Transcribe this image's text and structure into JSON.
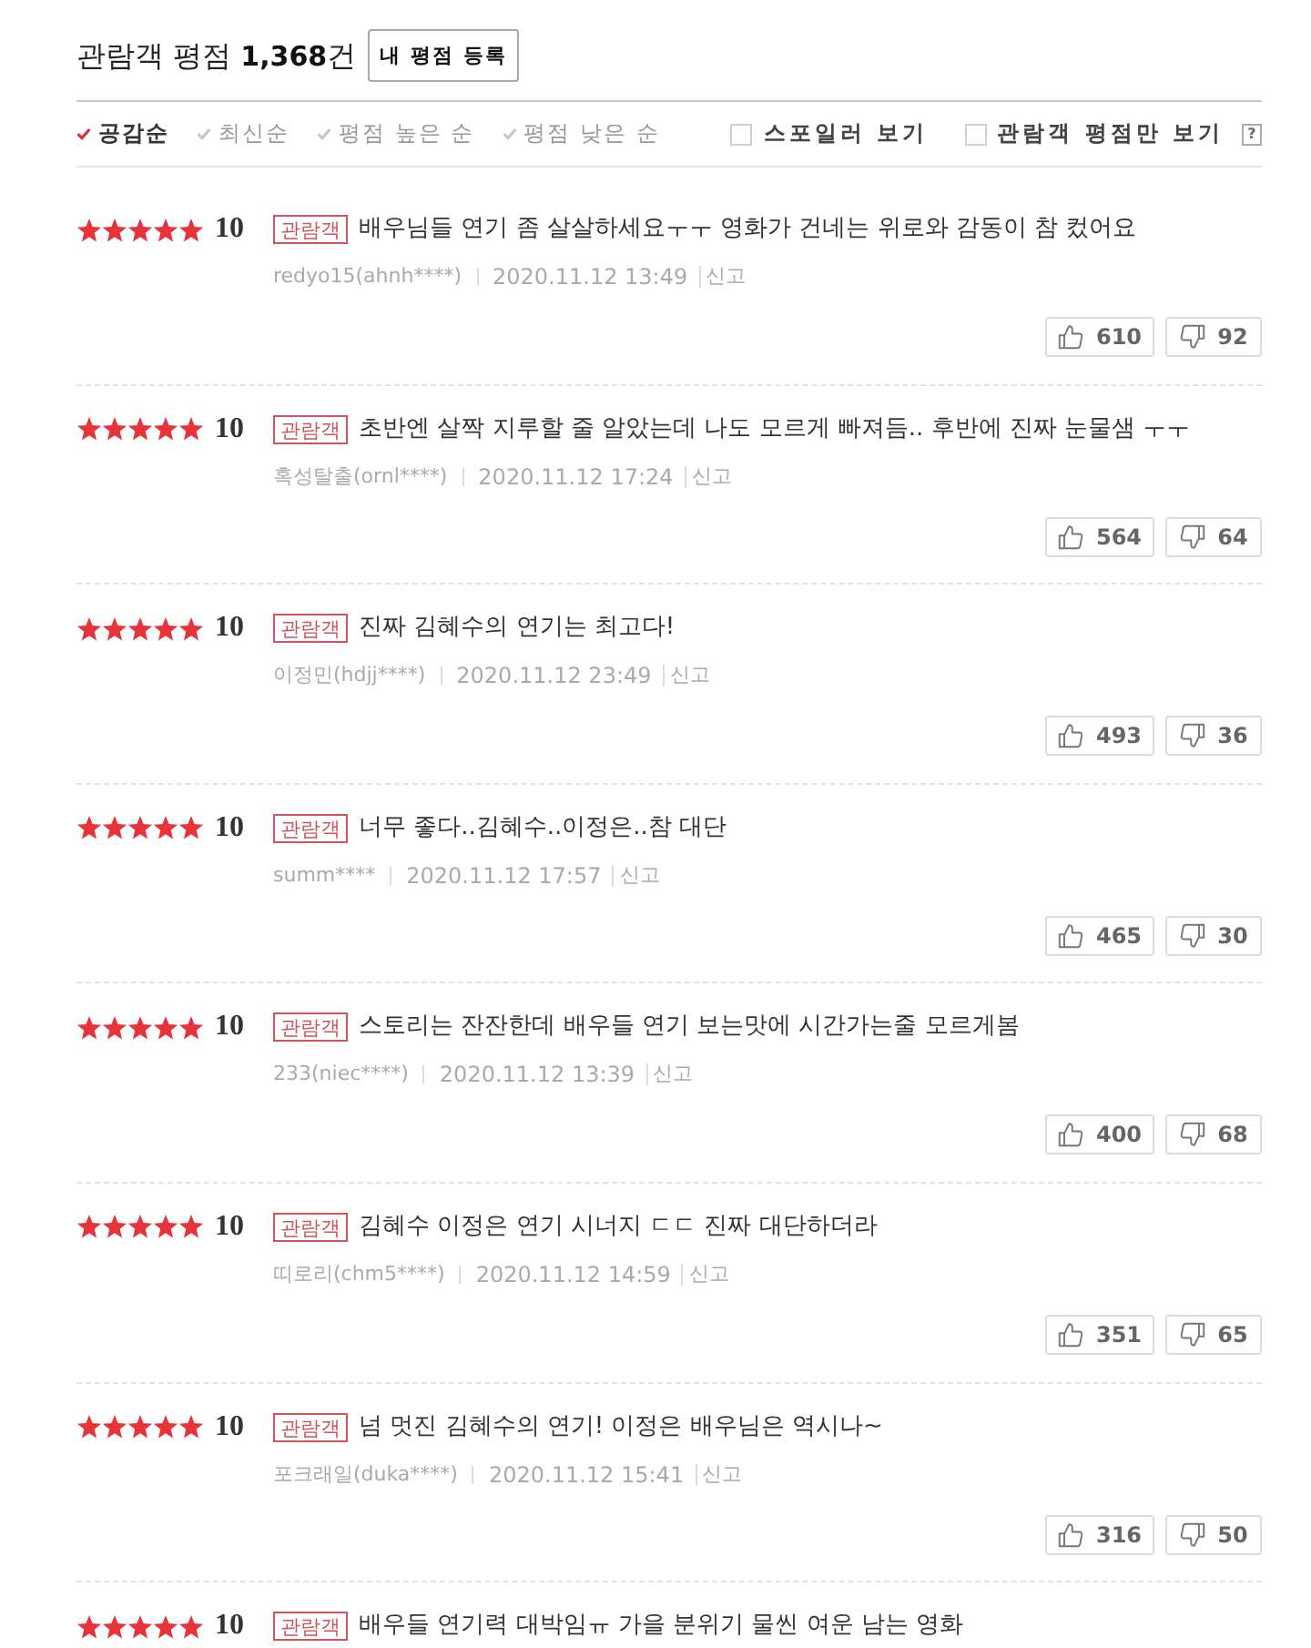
{
  "header": {
    "title": "관람객 평점 **1,368**건",
    "register_button": "내 평점 등록"
  },
  "sort_options": [
    {
      "label": "공감순",
      "selected": true
    },
    {
      "label": "최신순",
      "selected": false
    },
    {
      "label": "평점 높은 순",
      "selected": false
    },
    {
      "label": "평점 낮은 순",
      "selected": false
    }
  ],
  "filters": [
    {
      "label": "스포일러 보기",
      "checked": false
    },
    {
      "label": "관람객 평점만 보기",
      "checked": false
    }
  ],
  "help": "?",
  "reviews": [
    {
      "stars": 5,
      "score": "10",
      "badge": "관람객",
      "text": "배우님들 연기 좀 살살하세요ㅜㅜ 영화가 건네는 위로와 감동이 참 컸어요",
      "author": "redyo15(ahnh****)",
      "date": "2020.11.12 13:49",
      "report": "신고",
      "likes": "610",
      "dislikes": "92"
    },
    {
      "stars": 5,
      "score": "10",
      "badge": "관람객",
      "text": "초반엔 살짝 지루할 줄 알았는데 나도 모르게 빠져듬.. 후반에 진짜 눈물샘 ㅜㅜ",
      "author": "혹성탈출(ornl****)",
      "date": "2020.11.12 17:24",
      "report": "신고",
      "likes": "564",
      "dislikes": "64"
    },
    {
      "stars": 5,
      "score": "10",
      "badge": "관람객",
      "text": "진짜 김혜수의 연기는 최고다!",
      "author": "이정민(hdjj****)",
      "date": "2020.11.12 23:49",
      "report": "신고",
      "likes": "493",
      "dislikes": "36"
    },
    {
      "stars": 5,
      "score": "10",
      "badge": "관람객",
      "text": "너무 좋다..김혜수..이정은..참 대단",
      "author": "summ****",
      "date": "2020.11.12 17:57",
      "report": "신고",
      "likes": "465",
      "dislikes": "30"
    },
    {
      "stars": 5,
      "score": "10",
      "badge": "관람객",
      "text": "스토리는 잔잔한데 배우들 연기 보는맛에 시간가는줄 모르게봄",
      "author": "233(niec****)",
      "date": "2020.11.12 13:39",
      "report": "신고",
      "likes": "400",
      "dislikes": "68"
    },
    {
      "stars": 5,
      "score": "10",
      "badge": "관람객",
      "text": "김혜수 이정은 연기 시너지 ㄷㄷ 진짜 대단하더라",
      "author": "띠로리(chm5****)",
      "date": "2020.11.12 14:59",
      "report": "신고",
      "likes": "351",
      "dislikes": "65"
    },
    {
      "stars": 5,
      "score": "10",
      "badge": "관람객",
      "text": "넘 멋진 김혜수의 연기! 이정은 배우님은 역시나~",
      "author": "포크래일(duka****)",
      "date": "2020.11.12 15:41",
      "report": "신고",
      "likes": "316",
      "dislikes": "50"
    },
    {
      "stars": 5,
      "score": "10",
      "badge": "관람객",
      "text": "배우들 연기력 대박임ㅠ 가을 분위기 물씬 여운 남는 영화"
    }
  ]
}
